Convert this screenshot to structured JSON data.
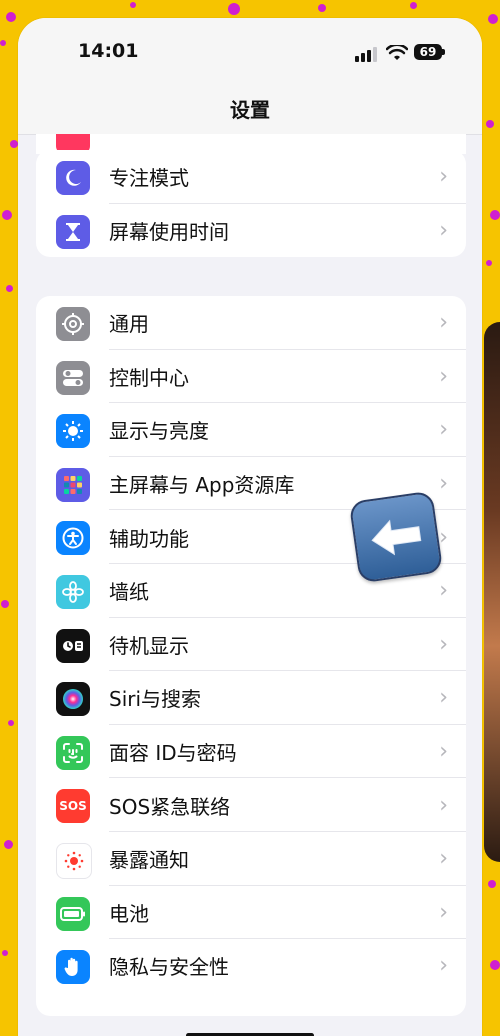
{
  "status": {
    "time": "14:01",
    "battery_level": "69",
    "signal_bars": 3,
    "wifi": "wifi-icon"
  },
  "nav": {
    "title": "设置"
  },
  "group_top": {
    "items": [
      {
        "label": "专注模式",
        "icon": "moon-icon",
        "color": "#5e5ce6"
      },
      {
        "label": "屏幕使用时间",
        "icon": "hourglass-icon",
        "color": "#5e5ce6"
      }
    ]
  },
  "group_main": {
    "items": [
      {
        "label": "通用",
        "icon": "gear-icon",
        "color": "#8e8e93"
      },
      {
        "label": "控制中心",
        "icon": "toggles-icon",
        "color": "#8e8e93"
      },
      {
        "label": "显示与亮度",
        "icon": "sun-icon",
        "color": "#0a84ff"
      },
      {
        "label": "主屏幕与 App资源库",
        "icon": "app-grid-icon",
        "color": "#5e5ce6"
      },
      {
        "label": "辅助功能",
        "icon": "accessibility-icon",
        "color": "#0a84ff"
      },
      {
        "label": "墙纸",
        "icon": "flower-icon",
        "color": "#40c8e0"
      },
      {
        "label": "待机显示",
        "icon": "standby-icon",
        "color": "#111111"
      },
      {
        "label": "Siri与搜索",
        "icon": "siri-icon",
        "color": "#111111"
      },
      {
        "label": "面容 ID与密码",
        "icon": "faceid-icon",
        "color": "#34c759"
      },
      {
        "label": "SOS紧急联络",
        "icon": "sos-icon",
        "color": "#ff3b30",
        "icon_text": "SOS"
      },
      {
        "label": "暴露通知",
        "icon": "exposure-icon",
        "color": "#ffffff"
      },
      {
        "label": "电池",
        "icon": "battery-icon",
        "color": "#34c759"
      },
      {
        "label": "隐私与安全性",
        "icon": "hand-icon",
        "color": "#0a84ff"
      }
    ]
  },
  "overlay": {
    "icon": "back-arrow-icon"
  },
  "theme": {
    "background": "#f6c400",
    "dots": "#d01fd0",
    "chevron": "#b6b6bb"
  }
}
